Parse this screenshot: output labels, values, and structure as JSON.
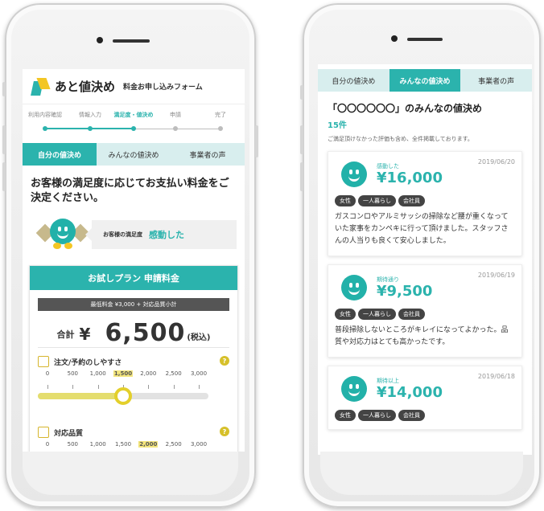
{
  "left_phone": {
    "header": {
      "brand": "あと値決め",
      "subtitle": "料金お申し込みフォーム"
    },
    "steps": [
      {
        "label": "利用内容確認",
        "state": "done"
      },
      {
        "label": "情報入力",
        "state": "done"
      },
      {
        "label": "満足度・値決め",
        "state": "active"
      },
      {
        "label": "申請",
        "state": "todo"
      },
      {
        "label": "完了",
        "state": "todo"
      }
    ],
    "tabs": [
      {
        "label": "自分の値決め",
        "active": true
      },
      {
        "label": "みんなの値決め",
        "active": false
      },
      {
        "label": "事業者の声",
        "active": false
      }
    ],
    "intro": "お客様の満足度に応じてお支払い料金をご決定ください。",
    "satisfaction": {
      "label": "お客様の満足度",
      "value": "感動した"
    },
    "plan": {
      "title": "お試しプラン 申請料金",
      "min_fee": "最低料金 ¥3,000 + 対応品質小計",
      "total_label": "合計",
      "currency": "¥",
      "total": "6,500",
      "tax": "(税込)"
    },
    "criteria": [
      {
        "name": "注文/予約のしやすさ",
        "icon": "building-icon",
        "help": "?",
        "ticks": [
          "0",
          "500",
          "1,000",
          "1,500",
          "2,000",
          "2,500",
          "3,000"
        ],
        "selected_index": 3,
        "level": 0.5
      },
      {
        "name": "対応品質",
        "icon": "person-icon",
        "help": "?",
        "ticks": [
          "0",
          "500",
          "1,000",
          "1,500",
          "2,000",
          "2,500",
          "3,000"
        ],
        "selected_index": 4,
        "level": 0.6667
      }
    ]
  },
  "right_phone": {
    "tabs": [
      {
        "label": "自分の値決め",
        "active": false
      },
      {
        "label": "みんなの値決め",
        "active": true
      },
      {
        "label": "事業者の声",
        "active": false
      }
    ],
    "title": "「〇〇〇〇〇〇」のみんなの値決め",
    "count": "15件",
    "note": "ご満足頂けなかった評価も含め、全件掲載しております。",
    "reviews": [
      {
        "satisfaction": "感動した",
        "price": "¥16,000",
        "date": "2019/06/20",
        "tags": [
          "女性",
          "一人暮らし",
          "会社員"
        ],
        "text": "ガスコンロやアルミサッシの掃除など腰が重くなっていた家事をカンペキに行って頂けました。スタッフさんの人当りも良くて安心しました。"
      },
      {
        "satisfaction": "期待通り",
        "price": "¥9,500",
        "date": "2019/06/19",
        "tags": [
          "女性",
          "一人暮らし",
          "会社員"
        ],
        "text": "普段掃除しないところがキレイになってよかった。品質や対応力はとても高かったです。"
      },
      {
        "satisfaction": "期待以上",
        "price": "¥14,000",
        "date": "2019/06/18",
        "tags": [
          "女性",
          "一人暮らし",
          "会社員"
        ],
        "text": ""
      }
    ]
  },
  "colors": {
    "accent": "#2bb3ad",
    "highlight": "#e3cf2b",
    "tab_bg": "#d8eeee"
  }
}
